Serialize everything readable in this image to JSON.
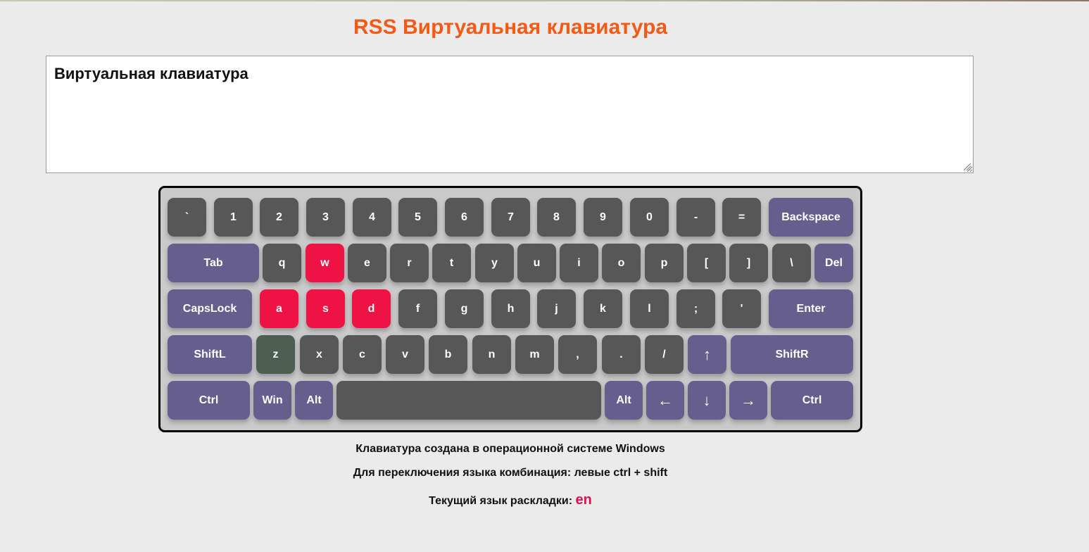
{
  "header": {
    "title": "RSS Виртуальная клавиатура"
  },
  "textarea": {
    "value": "Виртуальная клавиатура"
  },
  "keyboard": {
    "rows": [
      [
        {
          "label": "`",
          "name": "key-backquote"
        },
        {
          "label": "1",
          "name": "key-1"
        },
        {
          "label": "2",
          "name": "key-2"
        },
        {
          "label": "3",
          "name": "key-3"
        },
        {
          "label": "4",
          "name": "key-4"
        },
        {
          "label": "5",
          "name": "key-5"
        },
        {
          "label": "6",
          "name": "key-6"
        },
        {
          "label": "7",
          "name": "key-7"
        },
        {
          "label": "8",
          "name": "key-8"
        },
        {
          "label": "9",
          "name": "key-9"
        },
        {
          "label": "0",
          "name": "key-0"
        },
        {
          "label": "-",
          "name": "key-minus"
        },
        {
          "label": "=",
          "name": "key-equal"
        },
        {
          "label": "Backspace",
          "name": "key-backspace"
        }
      ],
      [
        {
          "label": "Tab",
          "name": "key-tab"
        },
        {
          "label": "q",
          "name": "key-q"
        },
        {
          "label": "w",
          "name": "key-w"
        },
        {
          "label": "e",
          "name": "key-e"
        },
        {
          "label": "r",
          "name": "key-r"
        },
        {
          "label": "t",
          "name": "key-t"
        },
        {
          "label": "y",
          "name": "key-y"
        },
        {
          "label": "u",
          "name": "key-u"
        },
        {
          "label": "i",
          "name": "key-i"
        },
        {
          "label": "o",
          "name": "key-o"
        },
        {
          "label": "p",
          "name": "key-p"
        },
        {
          "label": "[",
          "name": "key-bracket-left"
        },
        {
          "label": "]",
          "name": "key-bracket-right"
        },
        {
          "label": "\\",
          "name": "key-backslash"
        },
        {
          "label": "Del",
          "name": "key-delete"
        }
      ],
      [
        {
          "label": "CapsLock",
          "name": "key-capslock"
        },
        {
          "label": "a",
          "name": "key-a"
        },
        {
          "label": "s",
          "name": "key-s"
        },
        {
          "label": "d",
          "name": "key-d"
        },
        {
          "label": "f",
          "name": "key-f"
        },
        {
          "label": "g",
          "name": "key-g"
        },
        {
          "label": "h",
          "name": "key-h"
        },
        {
          "label": "j",
          "name": "key-j"
        },
        {
          "label": "k",
          "name": "key-k"
        },
        {
          "label": "l",
          "name": "key-l"
        },
        {
          "label": ";",
          "name": "key-semicolon"
        },
        {
          "label": "'",
          "name": "key-quote"
        },
        {
          "label": "Enter",
          "name": "key-enter"
        }
      ],
      [
        {
          "label": "ShiftL",
          "name": "key-shift-left"
        },
        {
          "label": "z",
          "name": "key-z"
        },
        {
          "label": "x",
          "name": "key-x"
        },
        {
          "label": "c",
          "name": "key-c"
        },
        {
          "label": "v",
          "name": "key-v"
        },
        {
          "label": "b",
          "name": "key-b"
        },
        {
          "label": "n",
          "name": "key-n"
        },
        {
          "label": "m",
          "name": "key-m"
        },
        {
          "label": ",",
          "name": "key-comma"
        },
        {
          "label": ".",
          "name": "key-period"
        },
        {
          "label": "/",
          "name": "key-slash"
        },
        {
          "label": "↑",
          "name": "key-arrow-up"
        },
        {
          "label": "ShiftR",
          "name": "key-shift-right"
        }
      ],
      [
        {
          "label": "Ctrl",
          "name": "key-ctrl-left"
        },
        {
          "label": "Win",
          "name": "key-win"
        },
        {
          "label": "Alt",
          "name": "key-alt-left"
        },
        {
          "label": "",
          "name": "key-space"
        },
        {
          "label": "Alt",
          "name": "key-alt-right"
        },
        {
          "label": "←",
          "name": "key-arrow-left"
        },
        {
          "label": "↓",
          "name": "key-arrow-down"
        },
        {
          "label": "→",
          "name": "key-arrow-right"
        },
        {
          "label": "Ctrl",
          "name": "key-ctrl-right"
        }
      ]
    ],
    "colors": {
      "regular": "#575757",
      "special": "#665e8c",
      "active": "#ef1244",
      "hover": "#4b5e51"
    }
  },
  "footer": {
    "line1": "Клавиатура создана в операционной системе Windows",
    "line2": "Для переключения языка комбинация: левые ctrl + shift",
    "line3_label": "Текущий язык раскладки:",
    "current_lang": "en"
  }
}
